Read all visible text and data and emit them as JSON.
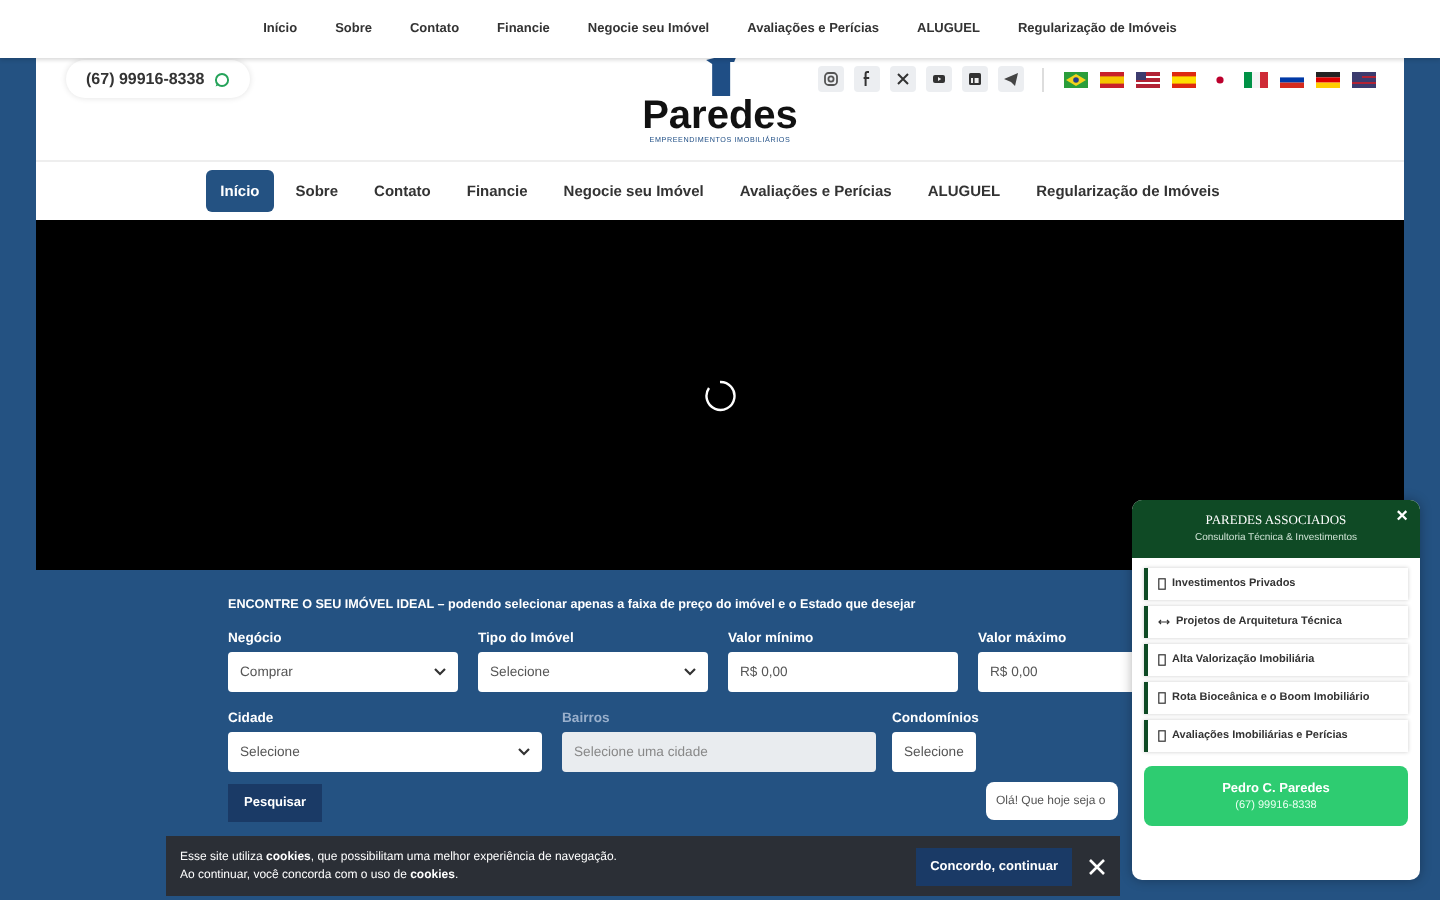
{
  "top_nav": [
    {
      "label": "Início"
    },
    {
      "label": "Sobre"
    },
    {
      "label": "Contato"
    },
    {
      "label": "Financie"
    },
    {
      "label": "Negocie seu Imóvel"
    },
    {
      "label": "Avaliações e Perícias"
    },
    {
      "label": "ALUGUEL"
    },
    {
      "label": "Regularização de Imóveis"
    }
  ],
  "header": {
    "phone": "(67) 99916-8338",
    "logo_name": "Paredes",
    "logo_tagline": "EMPREENDIMENTOS IMOBILIÁRIOS"
  },
  "main_nav": [
    {
      "label": "Início",
      "selected": true
    },
    {
      "label": "Sobre",
      "selected": false
    },
    {
      "label": "Contato",
      "selected": false
    },
    {
      "label": "Financie",
      "selected": false
    },
    {
      "label": "Negocie seu Imóvel",
      "selected": false
    },
    {
      "label": "Avaliações e Perícias",
      "selected": false
    },
    {
      "label": "ALUGUEL",
      "selected": false
    },
    {
      "label": "Regularização de Imóveis",
      "selected": false
    }
  ],
  "search": {
    "title": "ENCONTRE O SEU IMÓVEL IDEAL – podendo selecionar apenas a faixa de preço do imóvel e o Estado que desejar",
    "rows": [
      [
        {
          "label": "Negócio",
          "kind": "select",
          "value": "Comprar",
          "disabled": false
        },
        {
          "label": "Tipo do Imóvel",
          "kind": "select",
          "value": "Selecione",
          "disabled": false
        },
        {
          "label": "Valor mínimo",
          "kind": "input",
          "value": "R$ 0,00",
          "disabled": false
        },
        {
          "label": "Valor máximo",
          "kind": "input",
          "value": "R$ 0,00",
          "disabled": false
        }
      ],
      [
        {
          "label": "Cidade",
          "kind": "select",
          "value": "Selecione",
          "disabled": false
        },
        {
          "label": "Bairros",
          "kind": "select",
          "value": "Selecione uma cidade",
          "disabled": true
        },
        {
          "label": "Condomínios",
          "kind": "select",
          "value": "Selecione",
          "disabled": false
        }
      ]
    ],
    "button": "Pesquisar"
  },
  "chat_bubble": "Olá! Que hoje seja o",
  "cookie_bar": {
    "lines": [
      "Esse site utiliza **cookies**, que possibilitam uma melhor experiência de navegação.",
      "Ao continuar, você concorda com o uso de **cookies**."
    ],
    "button": "Concordo, continuar"
  },
  "widget": {
    "title": "PAREDES ASSOCIADOS",
    "subtitle": "Consultoria Técnica & Investimentos",
    "close": "×",
    "items": [
      {
        "kind": "box",
        "label": "Investimentos Privados"
      },
      {
        "kind": "arrows",
        "label": "Projetos de Arquitetura Técnica"
      },
      {
        "kind": "box",
        "label": "Alta Valorização Imobiliária"
      },
      {
        "kind": "box",
        "label": "Rota Bioceânica e o Boom Imobiliário"
      },
      {
        "kind": "box",
        "label": "Avaliações Imobiliárias e Perícias"
      }
    ],
    "contact_name": "Pedro C. Paredes",
    "contact_phone": "(67) 99916-8338"
  }
}
